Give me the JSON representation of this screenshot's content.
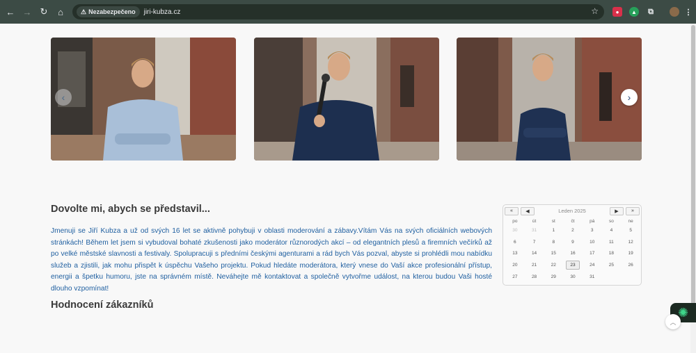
{
  "browser": {
    "security_label": "Nezabezpečeno",
    "url": "jiri-kubza.cz",
    "icons": [
      "back-icon",
      "forward-icon",
      "reload-icon",
      "home-icon",
      "warning-icon",
      "star-icon",
      "extension-icon",
      "profile-icon"
    ]
  },
  "carousel": {
    "prev_symbol": "‹",
    "next_symbol": "›",
    "slides": [
      {
        "alt": "photo-1"
      },
      {
        "alt": "photo-2"
      },
      {
        "alt": "photo-3"
      }
    ]
  },
  "intro": {
    "title": "Dovolte mi, abych se představil...",
    "text": "Jmenuji se Jiří Kubza a už od svých 16 let se aktivně pohybuji v oblasti moderování a zábavy.Vítám Vás na svých oficiálních webových stránkách! Během let jsem si vybudoval bohaté zkušenosti jako moderátor různorodých akcí – od elegantních plesů a firemních večírků až po velké městské slavnosti a festivaly. Spolupracuji s předními českými agenturami a rád bych Vás pozval, abyste si prohlédli mou nabídku služeb a zjistili, jak mohu přispět k úspěchu Vašeho projektu. Pokud hledáte moderátora, který vnese do Vaší akce profesionální přístup, energii a špetku humoru, jste na správném místě. Neváhejte mě kontaktovat a společně vytvořme událost, na kterou budou Vaši hosté dlouho vzpomínat!"
  },
  "reviews": {
    "title": "Hodnocení zákazníků"
  },
  "calendar": {
    "month_label": "Leden 2025",
    "prev_year": "«",
    "prev_month": "◀",
    "next_month": "▶",
    "next_year": "»",
    "weekdays": [
      "po",
      "út",
      "st",
      "čt",
      "pá",
      "so",
      "ne"
    ],
    "days": [
      {
        "d": "30",
        "other": true
      },
      {
        "d": "31",
        "other": true
      },
      {
        "d": "1",
        "other": false
      },
      {
        "d": "2",
        "other": false
      },
      {
        "d": "3",
        "other": false
      },
      {
        "d": "4",
        "other": false
      },
      {
        "d": "5",
        "other": false
      },
      {
        "d": "6",
        "other": false
      },
      {
        "d": "7",
        "other": false
      },
      {
        "d": "8",
        "other": false
      },
      {
        "d": "9",
        "other": false
      },
      {
        "d": "10",
        "other": false
      },
      {
        "d": "11",
        "other": false
      },
      {
        "d": "12",
        "other": false
      },
      {
        "d": "13",
        "other": false
      },
      {
        "d": "14",
        "other": false
      },
      {
        "d": "15",
        "other": false
      },
      {
        "d": "16",
        "other": false
      },
      {
        "d": "17",
        "other": false
      },
      {
        "d": "18",
        "other": false
      },
      {
        "d": "19",
        "other": false
      },
      {
        "d": "20",
        "other": false
      },
      {
        "d": "21",
        "other": false
      },
      {
        "d": "22",
        "other": false
      },
      {
        "d": "23",
        "other": false,
        "today": true
      },
      {
        "d": "24",
        "other": false
      },
      {
        "d": "25",
        "other": false
      },
      {
        "d": "26",
        "other": false
      },
      {
        "d": "27",
        "other": false
      },
      {
        "d": "28",
        "other": false
      },
      {
        "d": "29",
        "other": false
      },
      {
        "d": "30",
        "other": false
      },
      {
        "d": "31",
        "other": false
      },
      {
        "d": "",
        "other": true
      },
      {
        "d": "",
        "other": true
      }
    ]
  },
  "colors": {
    "chrome": "#3c4b45",
    "text_blue": "#1f5fa0",
    "heading": "#3a3a3a"
  }
}
